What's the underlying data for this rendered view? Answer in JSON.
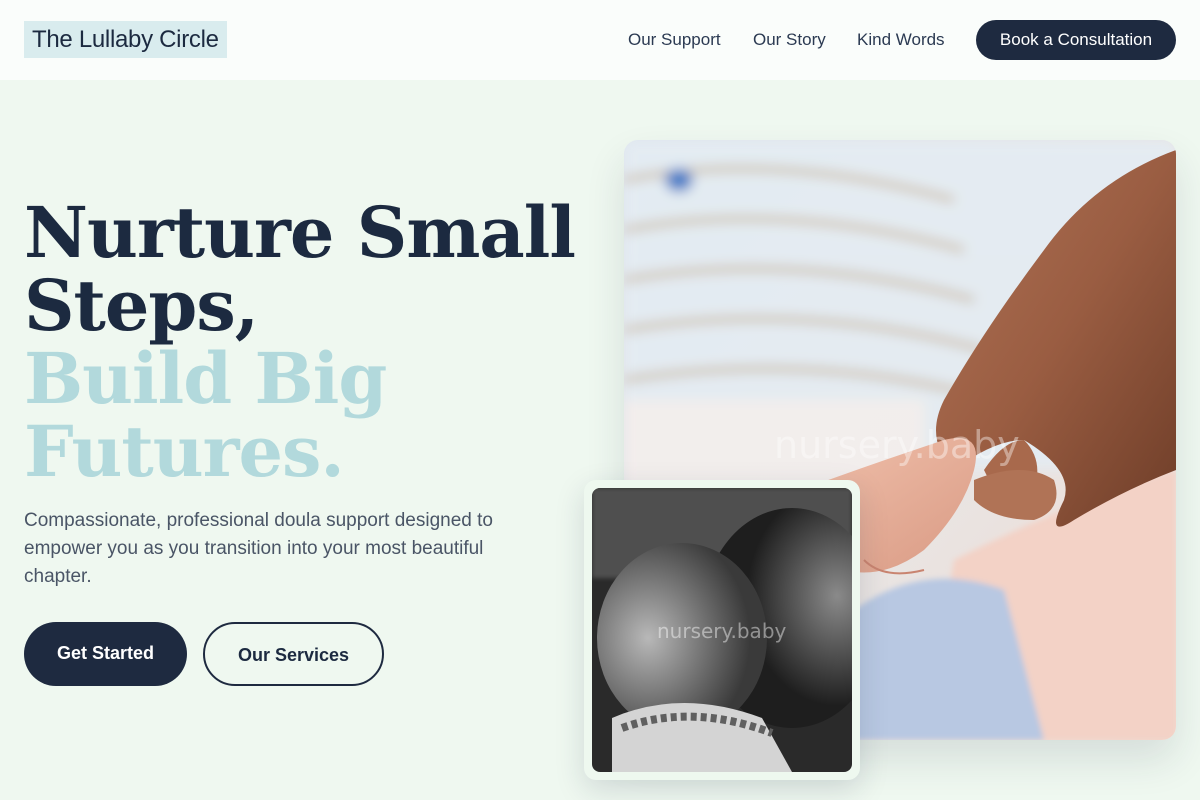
{
  "header": {
    "logo": "The Lullaby Circle",
    "nav": [
      "Our Support",
      "Our Story",
      "Kind Words"
    ],
    "cta": "Book a Consultation"
  },
  "hero": {
    "headline_dark_1": "Nurture Small",
    "headline_dark_2": "Steps,",
    "headline_light_1": "Build Big",
    "headline_light_2": "Futures.",
    "subtext": "Compassionate, professional doula support designed to empower you as you transition into your most beautiful chapter.",
    "primary_button": "Get Started",
    "secondary_button": "Our Services"
  },
  "images": {
    "main_watermark": "nursery.baby",
    "inset_watermark": "nursery.baby"
  },
  "colors": {
    "background": "#eff8f0",
    "navy": "#1e2a40",
    "accent_light": "#b2d9dc",
    "logo_bg": "#d9ecee"
  }
}
